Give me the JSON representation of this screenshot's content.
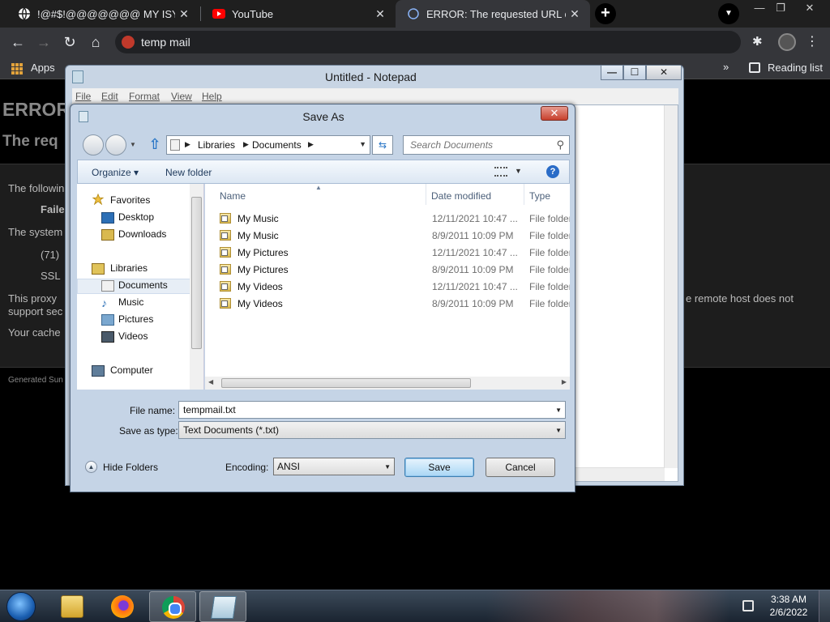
{
  "browser": {
    "tabs": [
      {
        "title": "!@#$!@@@@@@@ MY ISYS PF",
        "close": "✕"
      },
      {
        "title": "YouTube",
        "close": "✕"
      },
      {
        "title": "ERROR: The requested URL could",
        "close": "✕"
      }
    ],
    "new_tab": "+",
    "omnibox_text": "temp mail",
    "bookmarks": {
      "apps": "Apps",
      "overflow": "»",
      "reading_list": "Reading list"
    },
    "window_controls": {
      "minimize": "—",
      "restore": "❐",
      "close": "✕"
    }
  },
  "webpage": {
    "heading": "ERROR",
    "subheading": "The req",
    "lines": [
      "The followin",
      "Faile",
      "The system",
      "(71)",
      "SSL",
      "This proxy",
      "support sec",
      "Your cache",
      "e remote host does not"
    ],
    "generated": "Generated Sun"
  },
  "notepad": {
    "title": "Untitled - Notepad",
    "menu": [
      "File",
      "Edit",
      "Format",
      "View",
      "Help"
    ],
    "min": "—",
    "max": "☐",
    "close": "✕"
  },
  "save_dialog": {
    "title": "Save As",
    "close": "✕",
    "breadcrumb": [
      "Libraries",
      "Documents"
    ],
    "search_placeholder": "Search Documents",
    "organize": "Organize ▾",
    "new_folder": "New folder",
    "help": "?",
    "nav": {
      "favorites": "Favorites",
      "desktop": "Desktop",
      "downloads": "Downloads",
      "libraries": "Libraries",
      "documents": "Documents",
      "music": "Music",
      "pictures": "Pictures",
      "videos": "Videos",
      "computer": "Computer"
    },
    "columns": {
      "name": "Name",
      "date": "Date modified",
      "type": "Type"
    },
    "files": [
      {
        "name": "My Music",
        "date": "12/11/2021 10:47 ...",
        "type": "File folder"
      },
      {
        "name": "My Music",
        "date": "8/9/2011 10:09 PM",
        "type": "File folder"
      },
      {
        "name": "My Pictures",
        "date": "12/11/2021 10:47 ...",
        "type": "File folder"
      },
      {
        "name": "My Pictures",
        "date": "8/9/2011 10:09 PM",
        "type": "File folder"
      },
      {
        "name": "My Videos",
        "date": "12/11/2021 10:47 ...",
        "type": "File folder"
      },
      {
        "name": "My Videos",
        "date": "8/9/2011 10:09 PM",
        "type": "File folder"
      }
    ],
    "file_name_label": "File name:",
    "file_name_value": "tempmail.txt",
    "save_type_label": "Save as type:",
    "save_type_value": "Text Documents (*.txt)",
    "hide_folders": "Hide Folders",
    "encoding_label": "Encoding:",
    "encoding_value": "ANSI",
    "save": "Save",
    "cancel": "Cancel"
  },
  "taskbar": {
    "time": "3:38 AM",
    "date": "2/6/2022"
  }
}
